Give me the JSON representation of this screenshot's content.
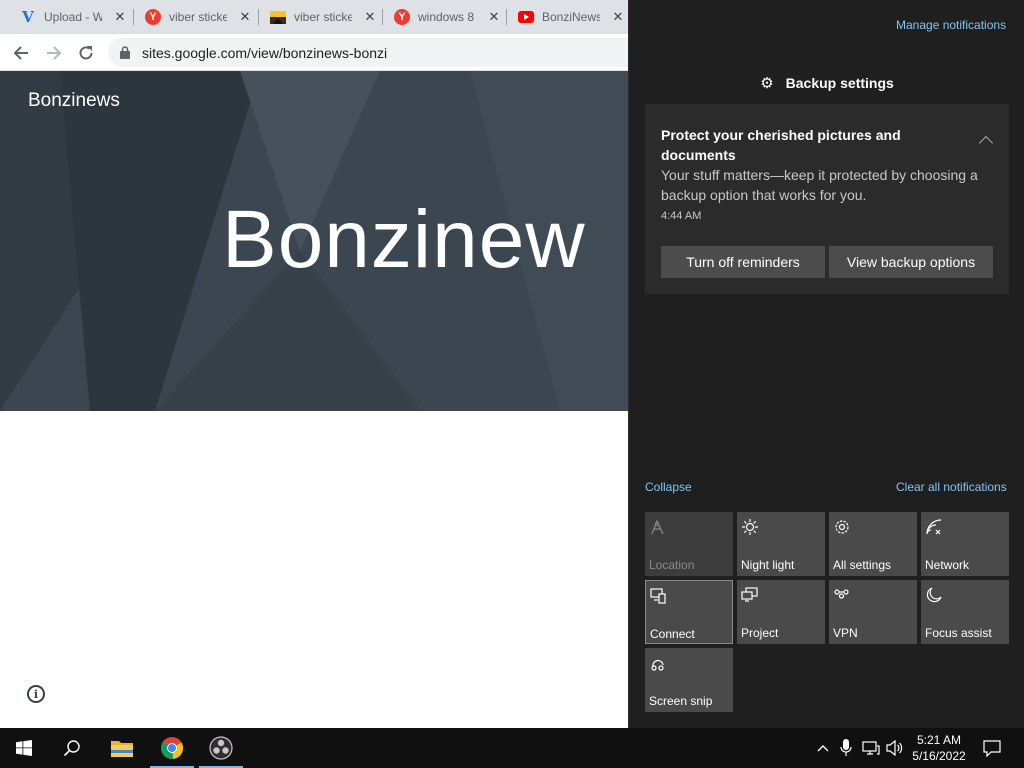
{
  "browser": {
    "tabs": [
      {
        "title": "Upload - W",
        "icon": "v-logo-icon"
      },
      {
        "title": "viber sticke",
        "icon": "yandex-icon"
      },
      {
        "title": "viber sticke",
        "icon": "image-icon"
      },
      {
        "title": "windows 8",
        "icon": "yandex-icon"
      },
      {
        "title": "BonziNews",
        "icon": "youtube-icon"
      }
    ],
    "url": "sites.google.com/view/bonzinews-bonzi"
  },
  "page": {
    "site_name": "Bonzinews",
    "hero_title": "Bonzinew"
  },
  "action_center": {
    "manage_notifications": "Manage notifications",
    "app_name": "Backup settings",
    "notification": {
      "title": "Protect your cherished pictures and documents",
      "body": "Your stuff matters—keep it protected by choosing a backup option that works for you.",
      "time": "4:44 AM",
      "button_off": "Turn off reminders",
      "button_view": "View backup options"
    },
    "collapse": "Collapse",
    "clear_all": "Clear all notifications",
    "quick_actions": [
      {
        "label": "Location",
        "icon": "location-icon",
        "state": "disabled"
      },
      {
        "label": "Night light",
        "icon": "night-light-icon",
        "state": "normal"
      },
      {
        "label": "All settings",
        "icon": "gear-icon",
        "state": "normal"
      },
      {
        "label": "Network",
        "icon": "network-icon",
        "state": "normal"
      },
      {
        "label": "Connect",
        "icon": "connect-icon",
        "state": "active"
      },
      {
        "label": "Project",
        "icon": "project-icon",
        "state": "normal"
      },
      {
        "label": "VPN",
        "icon": "vpn-icon",
        "state": "normal"
      },
      {
        "label": "Focus assist",
        "icon": "moon-icon",
        "state": "normal"
      },
      {
        "label": "Screen snip",
        "icon": "screen-snip-icon",
        "state": "normal"
      }
    ]
  },
  "taskbar": {
    "time": "5:21 AM",
    "date": "5/16/2022"
  },
  "colors": {
    "accent_link": "#82c5f5",
    "action_center_bg": "#1f1f1f",
    "tile_bg": "#4a4a4a"
  }
}
